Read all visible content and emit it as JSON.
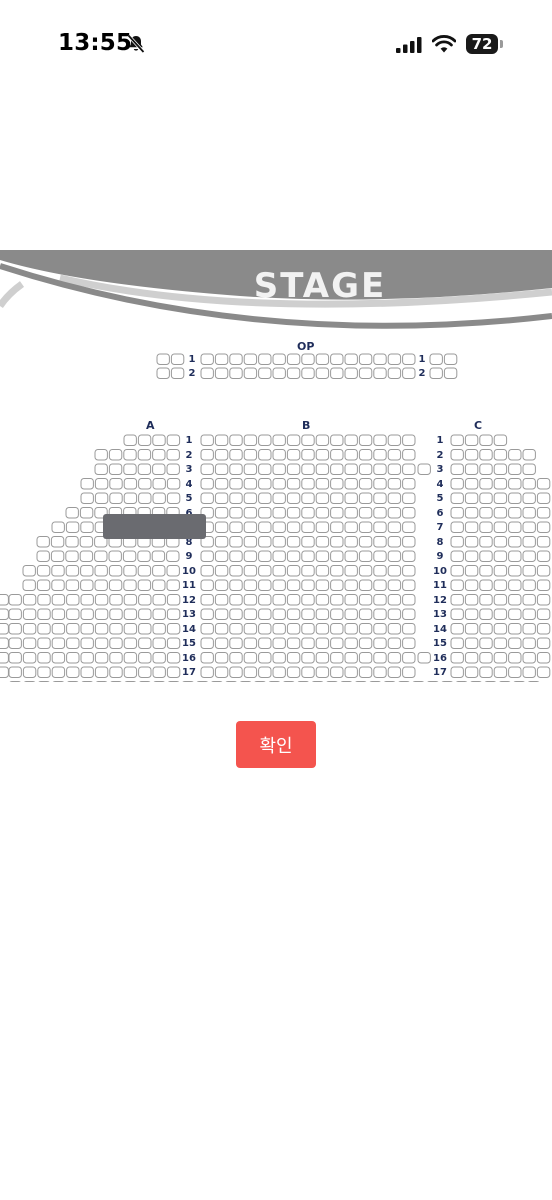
{
  "status_bar": {
    "time": "13:55",
    "battery": "72"
  },
  "seat_map": {
    "stage_label": "STAGE",
    "op_label": "OP",
    "op_rows": [
      "1",
      "2"
    ],
    "sections": [
      "A",
      "B",
      "C"
    ],
    "rows": [
      "1",
      "2",
      "3",
      "4",
      "5",
      "6",
      "7",
      "8",
      "9",
      "10",
      "11",
      "12",
      "13",
      "14",
      "15",
      "16",
      "17"
    ]
  },
  "confirm_button": "확인",
  "colors": {
    "stage": "#8a8a8a",
    "seat_border": "#9a9a9a",
    "label": "#1f2d5a",
    "button": "#f4544e",
    "overlay": "#6a6b70"
  }
}
